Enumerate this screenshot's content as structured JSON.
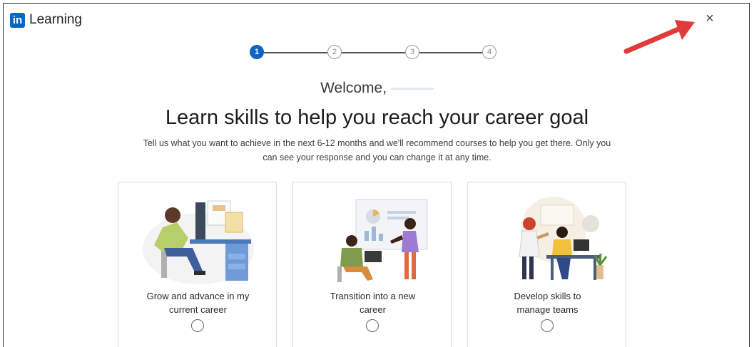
{
  "header": {
    "logo_text": "in",
    "app_name": "Learning",
    "close_symbol": "×"
  },
  "stepper": {
    "steps": [
      "1",
      "2",
      "3",
      "4"
    ],
    "current_step": 1
  },
  "welcome": {
    "text": "Welcome,"
  },
  "headline": "Learn skills to help you reach your career goal",
  "subtext": "Tell us what you want to achieve in the next 6-12 months and we'll recommend courses to help you get there. Only you can see your response and you can change it at any time.",
  "options": [
    {
      "label": "Grow and advance in my current career",
      "icon": "desk-worker-illustration",
      "selected": false
    },
    {
      "label": "Transition into a new career",
      "icon": "presentation-illustration",
      "selected": false
    },
    {
      "label": "Develop skills to manage teams",
      "icon": "team-meeting-illustration",
      "selected": false
    }
  ],
  "colors": {
    "brand": "#0a66c2",
    "annotation_arrow": "#e03a3a"
  }
}
